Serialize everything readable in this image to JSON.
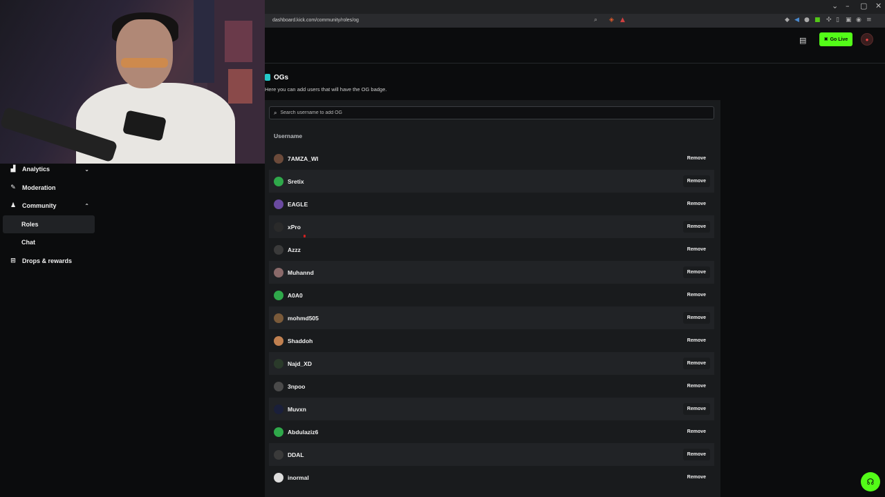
{
  "browser": {
    "url": "dashboard.kick.com/community/roles/og",
    "window_controls": [
      "⌄",
      "–",
      "▢",
      "✕"
    ]
  },
  "header": {
    "go_live_label": "Go Live",
    "store_icon": "store-icon",
    "avatar_icon": "user-avatar"
  },
  "sidebar": {
    "items": [
      {
        "label": "Analytics",
        "icon": "analytics-icon",
        "chevron": "⌄"
      },
      {
        "label": "Moderation",
        "icon": "wrench-icon"
      },
      {
        "label": "Community",
        "icon": "community-icon",
        "chevron": "⌃"
      },
      {
        "label": "Roles"
      },
      {
        "label": "Chat"
      },
      {
        "label": "Drops & rewards",
        "icon": "gift-icon"
      }
    ]
  },
  "main": {
    "title": "OGs",
    "description": "Here you can add users that will have the OG badge.",
    "search_placeholder": "Search username to add OG",
    "column_header": "Username",
    "remove_label": "Remove",
    "users": [
      {
        "name": "7AMZA_WI",
        "color": "#6b4a3a"
      },
      {
        "name": "Sretix",
        "color": "#2fa84a"
      },
      {
        "name": "EAGLE",
        "color": "#6a4aa0"
      },
      {
        "name": "xPro",
        "color": "#2a2a2a"
      },
      {
        "name": "Azzz",
        "color": "#3a3a3a"
      },
      {
        "name": "Muhannd",
        "color": "#8a6a6a"
      },
      {
        "name": "A0A0",
        "color": "#2fa84a"
      },
      {
        "name": "mohmd505",
        "color": "#7a5a3a"
      },
      {
        "name": "Shaddoh",
        "color": "#c08050"
      },
      {
        "name": "Najd_XD",
        "color": "#2a3a2a"
      },
      {
        "name": "3npoo",
        "color": "#4a4a4a"
      },
      {
        "name": "Muvxn",
        "color": "#1a1f3a"
      },
      {
        "name": "Abdulaziz6",
        "color": "#2fa84a"
      },
      {
        "name": "DDAL",
        "color": "#3a3a3a"
      },
      {
        "name": "inormal",
        "color": "#dddddd"
      }
    ]
  },
  "colors": {
    "accent": "#53fc18",
    "background": "#0b0c0d",
    "panel": "#191b1d"
  }
}
